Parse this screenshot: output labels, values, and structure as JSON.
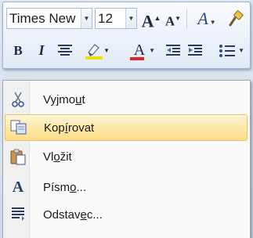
{
  "toolbar": {
    "font_name": "Times New",
    "font_size": "12",
    "grow_font_label": "A",
    "shrink_font_label": "A",
    "styles_label": "A",
    "bold_label": "B",
    "italic_label": "I",
    "font_color_label": "A",
    "highlight_color": "#f2e100",
    "font_color": "#e0202a"
  },
  "menu": {
    "items": [
      {
        "label_pre": "Vyjmo",
        "label_key": "u",
        "label_post": "t",
        "icon": "scissors-icon"
      },
      {
        "label_pre": "Kop",
        "label_key": "í",
        "label_post": "rovat",
        "icon": "copy-icon",
        "highlighted": true
      },
      {
        "label_pre": "Vl",
        "label_key": "o",
        "label_post": "žit",
        "icon": "paste-icon"
      },
      {
        "label_pre": "Písm",
        "label_key": "o",
        "label_post": "...",
        "icon": "font-icon"
      },
      {
        "label_pre": "Odstav",
        "label_key": "e",
        "label_post": "c...",
        "icon": "paragraph-icon"
      }
    ]
  }
}
